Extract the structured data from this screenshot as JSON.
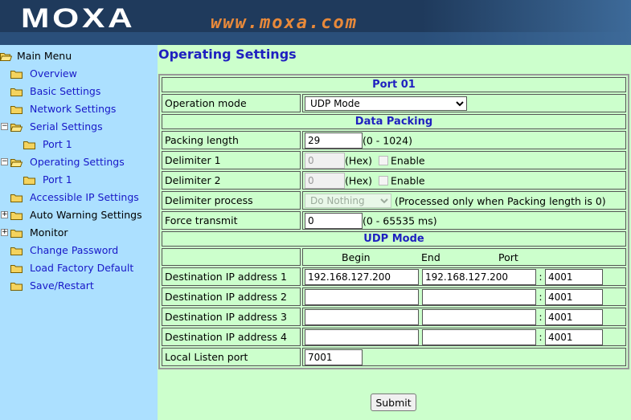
{
  "header": {
    "logo_text": "MOXA",
    "site_url": "www.moxa.com",
    "colors": {
      "banner": "#1f3a5c",
      "url": "#e8893a",
      "logo": "#ffffff"
    }
  },
  "sidebar": {
    "items": [
      {
        "label": "Main Menu",
        "icon": "folder-open-icon"
      },
      {
        "label": "Overview",
        "icon": "folder-icon"
      },
      {
        "label": "Basic Settings",
        "icon": "folder-icon"
      },
      {
        "label": "Network Settings",
        "icon": "folder-icon"
      },
      {
        "label": "Serial Settings",
        "icon": "folder-open-icon"
      },
      {
        "label": "Port 1",
        "icon": "folder-icon"
      },
      {
        "label": "Operating Settings",
        "icon": "folder-open-icon"
      },
      {
        "label": "Port 1",
        "icon": "folder-icon"
      },
      {
        "label": "Accessible IP Settings",
        "icon": "folder-icon"
      },
      {
        "label": "Auto Warning Settings",
        "icon": "folder-icon"
      },
      {
        "label": "Monitor",
        "icon": "folder-icon"
      },
      {
        "label": "Change Password",
        "icon": "folder-icon"
      },
      {
        "label": "Load Factory Default",
        "icon": "folder-icon"
      },
      {
        "label": "Save/Restart",
        "icon": "folder-icon"
      }
    ],
    "colors": {
      "background": "#ace0ff",
      "link": "#1818c8"
    }
  },
  "main": {
    "title": "Operating Settings",
    "port_header": "Port 01",
    "operation_mode": {
      "label": "Operation mode",
      "value": "UDP Mode"
    },
    "data_packing_header": "Data Packing",
    "packing_length": {
      "label": "Packing length",
      "value": "29",
      "range": "(0 - 1024)"
    },
    "delimiter1": {
      "label": "Delimiter 1",
      "value": "0",
      "unit": "(Hex)",
      "enable_label": "Enable"
    },
    "delimiter2": {
      "label": "Delimiter 2",
      "value": "0",
      "unit": "(Hex)",
      "enable_label": "Enable"
    },
    "delimiter_process": {
      "label": "Delimiter process",
      "value": "Do Nothing",
      "note": "(Processed only when Packing length is 0)"
    },
    "force_transmit": {
      "label": "Force transmit",
      "value": "0",
      "range": "(0 - 65535 ms)"
    },
    "udp_header": "UDP Mode",
    "columns": {
      "begin": "Begin",
      "end": "End",
      "port": "Port"
    },
    "destinations": [
      {
        "label": "Destination IP address 1",
        "begin": "192.168.127.200",
        "end": "192.168.127.200",
        "port": "4001"
      },
      {
        "label": "Destination IP address 2",
        "begin": "",
        "end": "",
        "port": "4001"
      },
      {
        "label": "Destination IP address 3",
        "begin": "",
        "end": "",
        "port": "4001"
      },
      {
        "label": "Destination IP address 4",
        "begin": "",
        "end": "",
        "port": "4001"
      }
    ],
    "local_listen_port": {
      "label": "Local Listen port",
      "value": "7001"
    },
    "colon": ":",
    "submit_label": "Submit",
    "colors": {
      "background": "#ccffcc",
      "heading": "#1f1fc0"
    }
  }
}
